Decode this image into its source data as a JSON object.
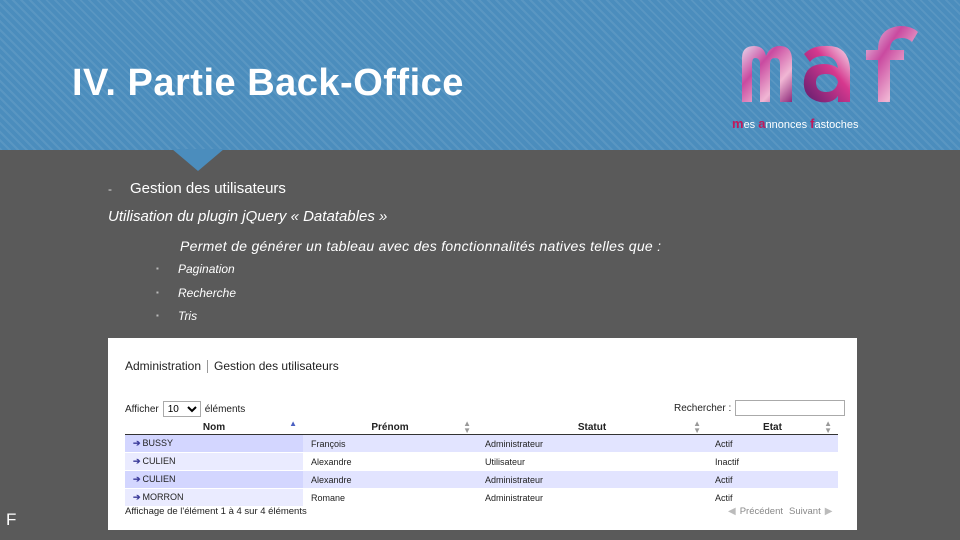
{
  "slide": {
    "title": "IV. Partie Back-Office",
    "footer_letter": "F"
  },
  "logo": {
    "wordmark": "maf",
    "tagline": {
      "m": "m",
      "es": "es",
      "a": "a",
      "nnonces": "nnonces",
      "f": "f",
      "astoches": "astoches"
    }
  },
  "content": {
    "section_dash": "-",
    "section": "Gestion des utilisateurs",
    "subtitle": "Utilisation du plugin jQuery « Datatables »",
    "description": "Permet de générer un tableau avec des fonctionnalités natives telles que :",
    "features": [
      "Pagination",
      "Recherche",
      "Tris"
    ]
  },
  "admin": {
    "breadcrumb": [
      "Administration",
      "Gestion des utilisateurs"
    ],
    "length_prefix": "Afficher",
    "length_value": "10",
    "length_suffix": "éléments",
    "search_label": "Rechercher :",
    "search_value": "",
    "columns": [
      "Nom",
      "Prénom",
      "Statut",
      "Etat"
    ],
    "rows": [
      [
        "BUSSY",
        "François",
        "Administrateur",
        "Actif"
      ],
      [
        "CULIEN",
        "Alexandre",
        "Utilisateur",
        "Inactif"
      ],
      [
        "CULIEN",
        "Alexandre",
        "Administrateur",
        "Actif"
      ],
      [
        "MORRON",
        "Romane",
        "Administrateur",
        "Actif"
      ]
    ],
    "info": "Affichage de l'élément 1 à 4 sur 4 éléments",
    "prev": "Précédent",
    "next": "Suivant"
  },
  "colors": {
    "header": "#4b8dbd",
    "background": "#5a5a5a",
    "row_odd": "#e2e4ff",
    "accent": "#c2185b"
  }
}
